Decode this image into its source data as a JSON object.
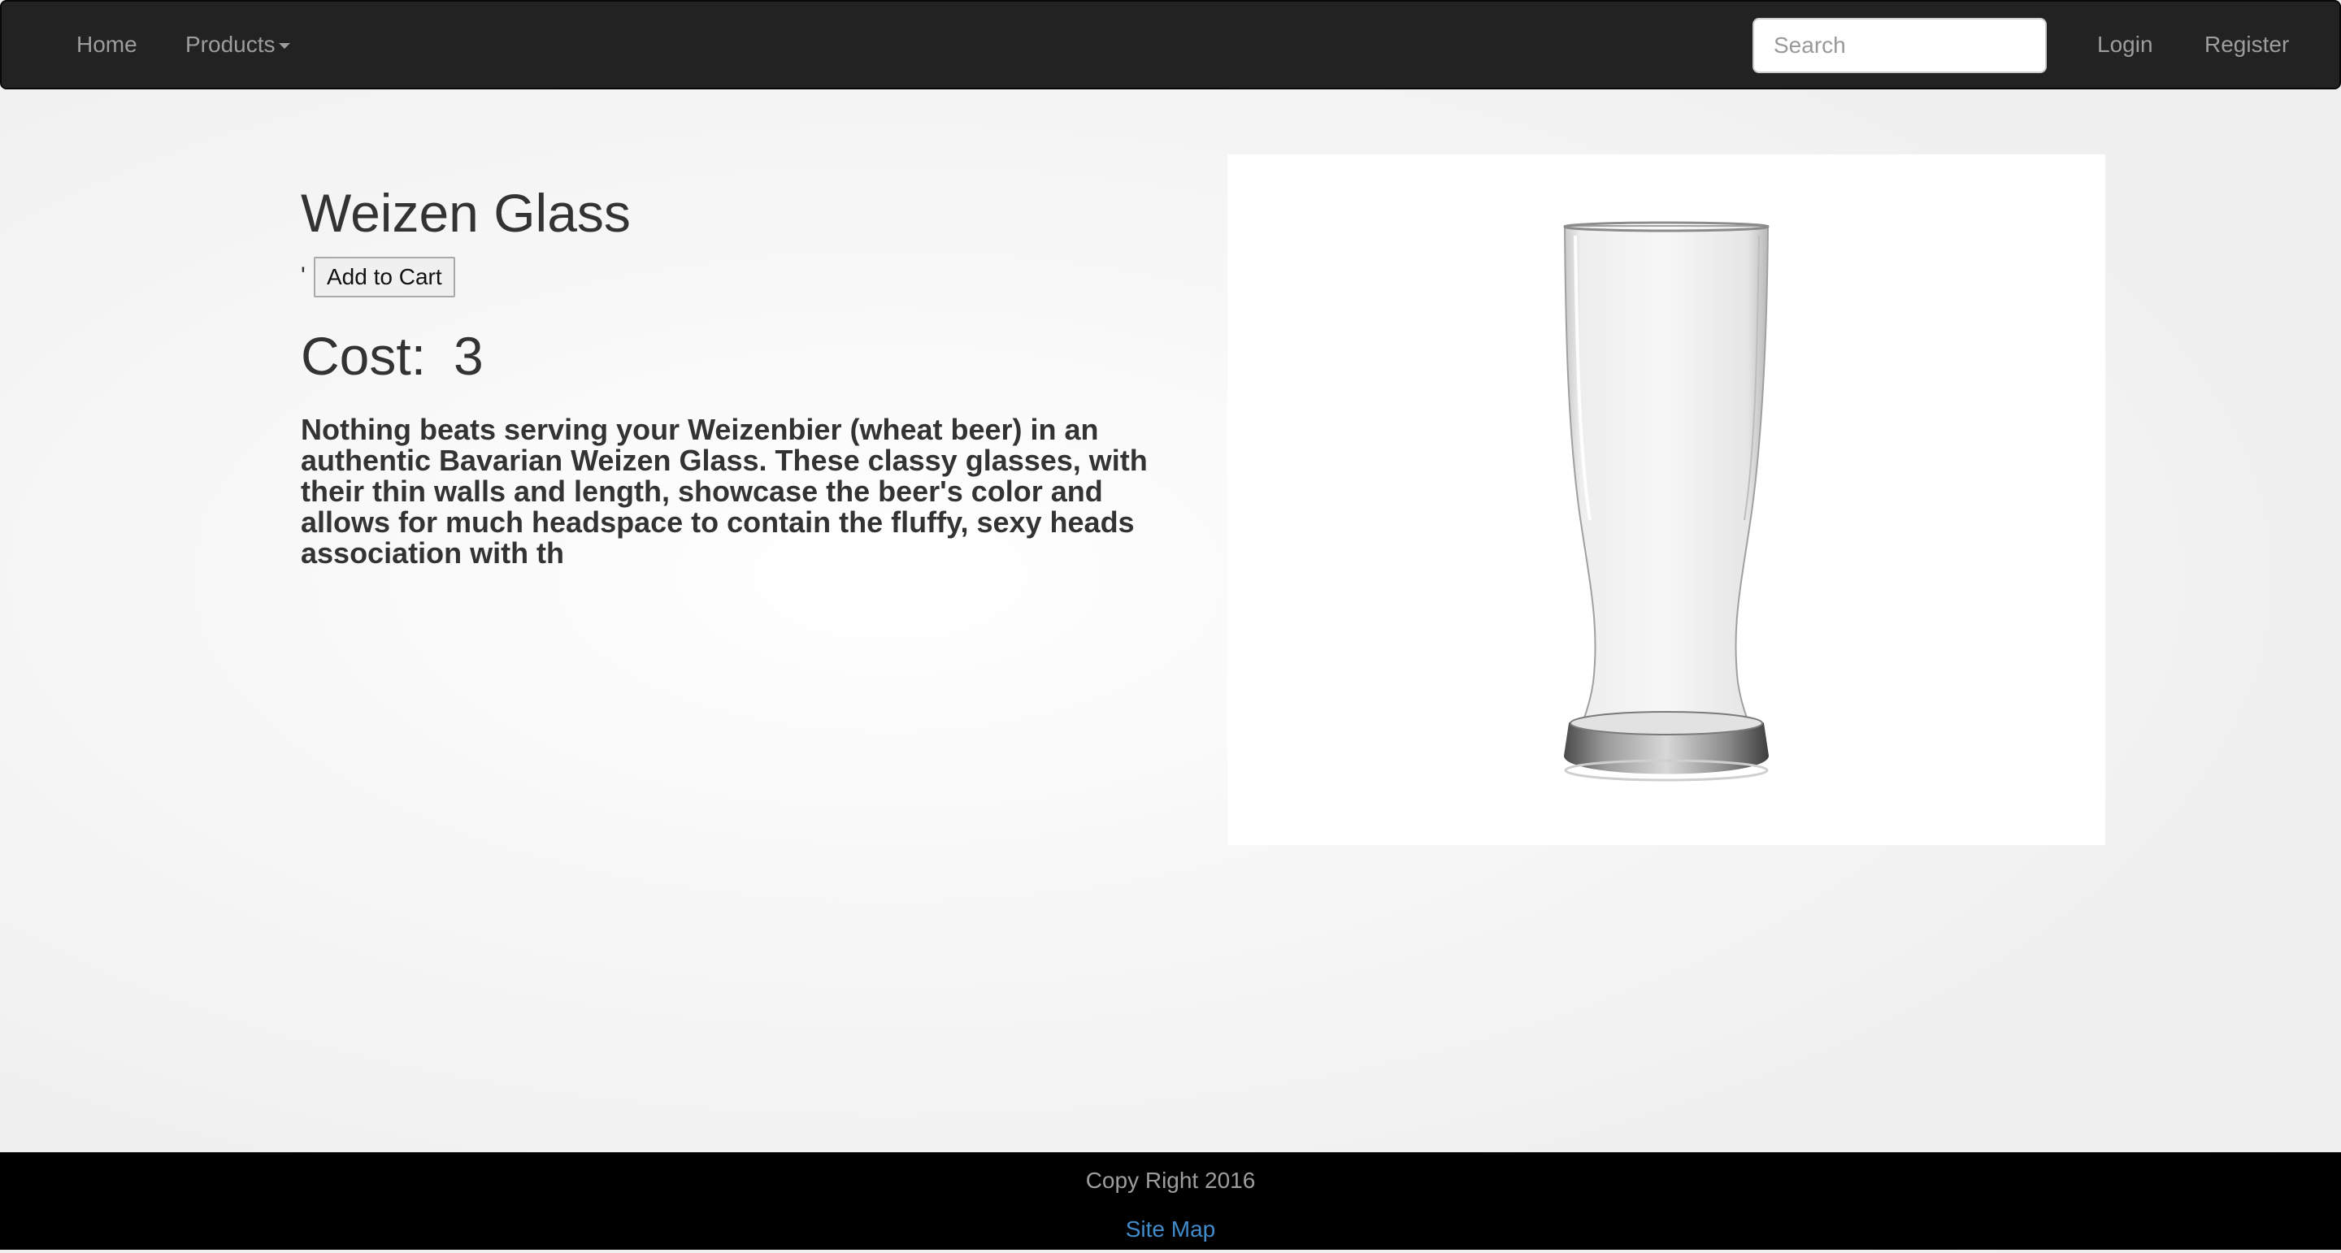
{
  "navbar": {
    "home_label": "Home",
    "products_label": "Products",
    "search_placeholder": "Search",
    "search_value": "",
    "login_label": "Login",
    "register_label": "Register"
  },
  "product": {
    "title": "Weizen Glass",
    "stray_text": "'",
    "add_to_cart_label": "Add to Cart",
    "cost_label": "Cost:",
    "cost_value": "3",
    "description": "Nothing beats serving your Weizenbier (wheat beer) in an authentic Bavarian Weizen Glass. These classy glasses, with their thin walls and length, showcase the beer's color and allows for much headspace to contain the fluffy, sexy heads association with th"
  },
  "footer": {
    "copyright": "Copy Right 2016",
    "sitemap_label": "Site Map"
  },
  "colors": {
    "navbar_bg": "#222222",
    "nav_text": "#9d9d9d",
    "footer_bg": "#000000",
    "link_blue": "#428bca",
    "heading_text": "#333333"
  }
}
